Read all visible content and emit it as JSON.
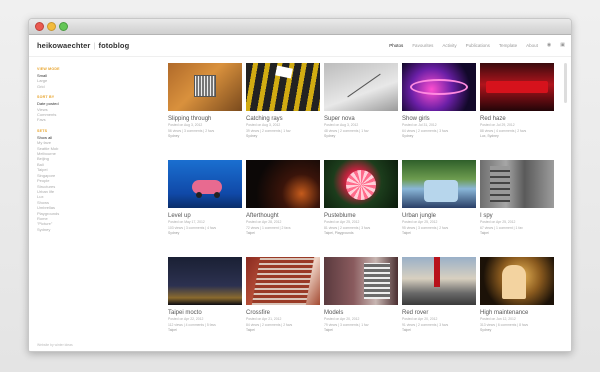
{
  "header": {
    "logo_bold": "heikowaechter",
    "logo_sep": "|",
    "logo_light": "fotoblog",
    "nav": [
      "Photos",
      "Favourites",
      "Activity",
      "Publications",
      "Template",
      "About"
    ],
    "active_nav": "Photos",
    "icons": [
      "rss-icon",
      "feed-icon"
    ]
  },
  "sidebar": {
    "sections": [
      {
        "title": "VIEW MODE",
        "items": [
          "Small",
          "Large",
          "Grid"
        ],
        "active": "Small"
      },
      {
        "title": "SORT BY",
        "items": [
          "Date posted",
          "Views",
          "Comments",
          "Favs"
        ],
        "active": "Date posted"
      },
      {
        "title": "SETS",
        "items": [
          "Show all",
          "My fave",
          "Seattle Mob",
          "Melbourne",
          "Beijing",
          "Bali",
          "Taipei",
          "Singapore",
          "People",
          "Structures",
          "Urban life",
          "Lux",
          "Shows",
          "Umbrellas",
          "Playgrounds",
          "Rome",
          "\"Picture\"",
          "Sydney"
        ],
        "active": "Show all"
      }
    ]
  },
  "photos": [
    {
      "title": "Slipping through",
      "posted": "Posted on Aug 3, 2012",
      "stats": "56 views | 3 comments | 2 favs",
      "tag": "Sydney"
    },
    {
      "title": "Catching rays",
      "posted": "Posted on Aug 3, 2012",
      "stats": "39 views | 2 comments | 1 fav",
      "tag": "Sydney"
    },
    {
      "title": "Super nova",
      "posted": "Posted on Aug 3, 2012",
      "stats": "48 views | 2 comments | 1 fav",
      "tag": "Sydney"
    },
    {
      "title": "Show girls",
      "posted": "Posted on Jul 31, 2012",
      "stats": "64 views | 2 comments | 3 favs",
      "tag": "Sydney"
    },
    {
      "title": "Red haze",
      "posted": "Posted on Jul 29, 2012",
      "stats": "88 views | 4 comments | 2 favs",
      "tag": "Lux, Sydney"
    },
    {
      "title": "Level up",
      "posted": "Posted on May 17, 2012",
      "stats": "103 views | 3 comments | 4 favs",
      "tag": "Sydney"
    },
    {
      "title": "Afterthought",
      "posted": "Posted on Apr 28, 2012",
      "stats": "72 views | 1 comment | 2 favs",
      "tag": "Taipei"
    },
    {
      "title": "Pusteblume",
      "posted": "Posted on Apr 25, 2012",
      "stats": "81 views | 2 comments | 3 favs",
      "tag": "Taipei, Playgrounds"
    },
    {
      "title": "Urban jungle",
      "posted": "Posted on Apr 25, 2012",
      "stats": "95 views | 3 comments | 2 favs",
      "tag": "Taipei"
    },
    {
      "title": "I spy",
      "posted": "Posted on Apr 25, 2012",
      "stats": "67 views | 1 comment | 1 fav",
      "tag": "Taipei"
    },
    {
      "title": "Taipei mocto",
      "posted": "Posted on Apr 22, 2012",
      "stats": "112 views | 4 comments | 5 favs",
      "tag": "Taipei"
    },
    {
      "title": "Crossfire",
      "posted": "Posted on Apr 21, 2012",
      "stats": "84 views | 2 comments | 2 favs",
      "tag": "Taipei"
    },
    {
      "title": "Models",
      "posted": "Posted on Apr 20, 2012",
      "stats": "79 views | 3 comments | 1 fav",
      "tag": "Taipei"
    },
    {
      "title": "Red rover",
      "posted": "Posted on Apr 20, 2012",
      "stats": "91 views | 2 comments | 3 favs",
      "tag": "Taipei"
    },
    {
      "title": "High maintenance",
      "posted": "Posted on Jun 12, 2012",
      "stats": "313 views | 6 comments | 8 favs",
      "tag": "Sydney"
    }
  ],
  "footer": "Website by winter ideas",
  "colors": {
    "accent": "#e8a32a",
    "text": "#555555",
    "muted": "#aaaaaa"
  }
}
